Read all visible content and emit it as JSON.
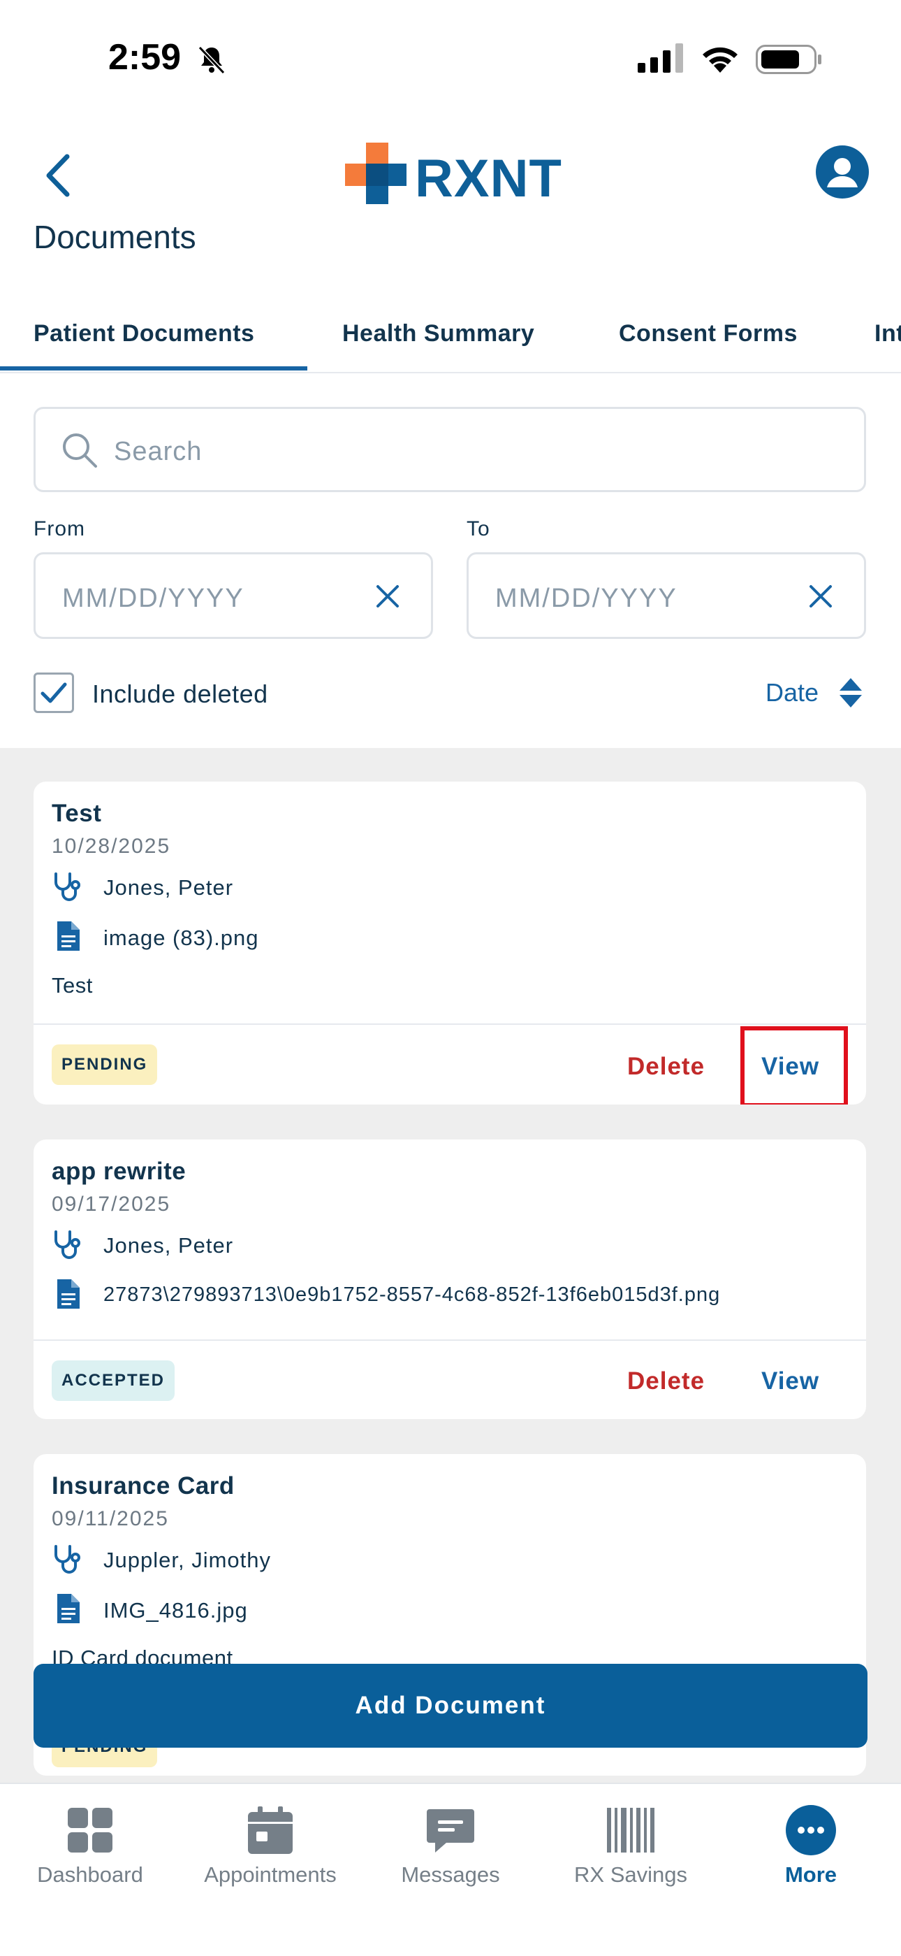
{
  "status_bar": {
    "time": "2:59"
  },
  "header": {
    "logo_text": "RXNT",
    "page_title": "Documents"
  },
  "tabs": [
    {
      "label": "Patient Documents",
      "active": true
    },
    {
      "label": "Health Summary",
      "active": false
    },
    {
      "label": "Consent Forms",
      "active": false
    },
    {
      "label": "Int",
      "active": false
    }
  ],
  "search": {
    "placeholder": "Search"
  },
  "filters": {
    "from_label": "From",
    "to_label": "To",
    "from_placeholder": "MM/DD/YYYY",
    "to_placeholder": "MM/DD/YYYY",
    "include_deleted_label": "Include deleted",
    "include_deleted_checked": true,
    "sort_label": "Date"
  },
  "documents": [
    {
      "title": "Test",
      "date": "10/28/2025",
      "provider": "Jones, Peter",
      "file": "image (83).png",
      "note": "Test",
      "status": "PENDING",
      "delete_label": "Delete",
      "view_label": "View"
    },
    {
      "title": "app rewrite",
      "date": "09/17/2025",
      "provider": "Jones, Peter",
      "file": "27873\\279893713\\0e9b1752-8557-4c68-852f-13f6eb015d3f.png",
      "note": "",
      "status": "ACCEPTED",
      "delete_label": "Delete",
      "view_label": "View"
    },
    {
      "title": "Insurance Card",
      "date": "09/11/2025",
      "provider": "Juppler, Jimothy",
      "file": "IMG_4816.jpg",
      "note": "ID Card document",
      "status": "PENDING"
    }
  ],
  "add_document_label": "Add Document",
  "bottom_nav": [
    {
      "label": "Dashboard",
      "icon": "dashboard-icon",
      "active": false
    },
    {
      "label": "Appointments",
      "icon": "calendar-icon",
      "active": false
    },
    {
      "label": "Messages",
      "icon": "message-icon",
      "active": false
    },
    {
      "label": "RX Savings",
      "icon": "barcode-icon",
      "active": false
    },
    {
      "label": "More",
      "icon": "more-icon",
      "active": true
    }
  ],
  "colors": {
    "brand_blue": "#0a5f9a",
    "link_blue": "#1764a4",
    "delete_red": "#c22a2a",
    "highlight_red": "#e0101c",
    "logo_orange": "#f47b3b"
  }
}
